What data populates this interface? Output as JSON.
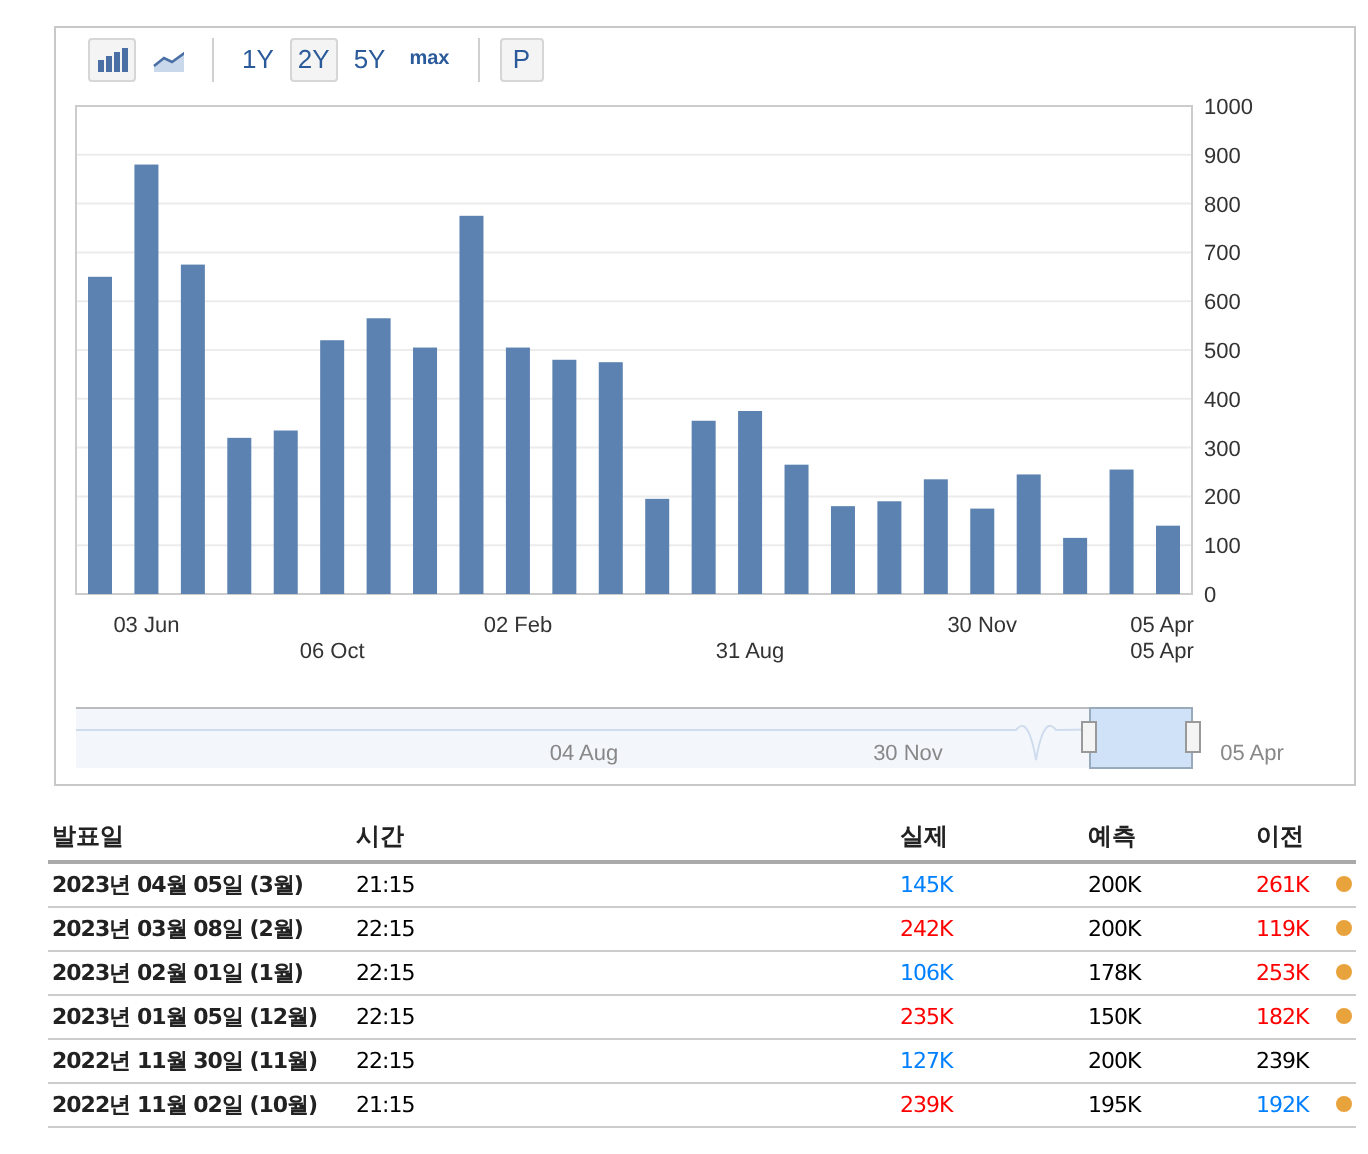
{
  "toolbar": {
    "chart_types": [
      {
        "kind": "bar",
        "selected": true
      },
      {
        "kind": "line",
        "selected": false
      }
    ],
    "ranges": [
      {
        "label": "1Y",
        "selected": false
      },
      {
        "label": "2Y",
        "selected": true
      },
      {
        "label": "5Y",
        "selected": false
      },
      {
        "label": "max",
        "selected": false
      }
    ],
    "buttons": [
      {
        "label": "P"
      }
    ]
  },
  "chart": {
    "chart_data": {
      "type": "bar",
      "grid": true,
      "series": [
        {
          "color": "#5b82b0",
          "values": [
            650,
            880,
            675,
            320,
            335,
            520,
            565,
            505,
            775,
            505,
            480,
            475,
            195,
            355,
            375,
            265,
            180,
            190,
            235,
            175,
            245,
            115,
            255,
            140
          ]
        }
      ],
      "ylim": [
        0,
        1000
      ],
      "yticks": [
        0,
        100,
        200,
        300,
        400,
        500,
        600,
        700,
        800,
        900,
        1000
      ]
    },
    "x_labels": [
      "03 Jun",
      "02 Feb",
      "30 Nov",
      "05 Apr",
      "06 Oct",
      "31 Aug",
      "05 Apr"
    ],
    "navigator": {
      "labels": [
        "04 Aug",
        "30 Nov",
        "05 Apr"
      ]
    }
  },
  "table": {
    "columns": [
      "발표일",
      "시간",
      "실제",
      "예측",
      "이전"
    ],
    "rows": [
      {
        "date": "2023년 04월 05일 (3월)",
        "time": "21:15",
        "actual": {
          "text": "145K",
          "color": "#0080ff"
        },
        "forecast": "200K",
        "previous": {
          "text": "261K",
          "color": "#ff0000"
        },
        "marker": true
      },
      {
        "date": "2023년 03월 08일 (2월)",
        "time": "22:15",
        "actual": {
          "text": "242K",
          "color": "#ff0000"
        },
        "forecast": "200K",
        "previous": {
          "text": "119K",
          "color": "#ff0000"
        },
        "marker": true
      },
      {
        "date": "2023년 02월 01일 (1월)",
        "time": "22:15",
        "actual": {
          "text": "106K",
          "color": "#0080ff"
        },
        "forecast": "178K",
        "previous": {
          "text": "253K",
          "color": "#ff0000"
        },
        "marker": true
      },
      {
        "date": "2023년 01월 05일 (12월)",
        "time": "22:15",
        "actual": {
          "text": "235K",
          "color": "#ff0000"
        },
        "forecast": "150K",
        "previous": {
          "text": "182K",
          "color": "#ff0000"
        },
        "marker": true
      },
      {
        "date": "2022년 11월 30일 (11월)",
        "time": "22:15",
        "actual": {
          "text": "127K",
          "color": "#0080ff"
        },
        "forecast": "200K",
        "previous": {
          "text": "239K",
          "color": "#000000"
        },
        "marker": false
      },
      {
        "date": "2022년 11월 02일 (10월)",
        "time": "21:15",
        "actual": {
          "text": "239K",
          "color": "#ff0000"
        },
        "forecast": "195K",
        "previous": {
          "text": "192K",
          "color": "#0080ff"
        },
        "marker": true
      }
    ]
  }
}
